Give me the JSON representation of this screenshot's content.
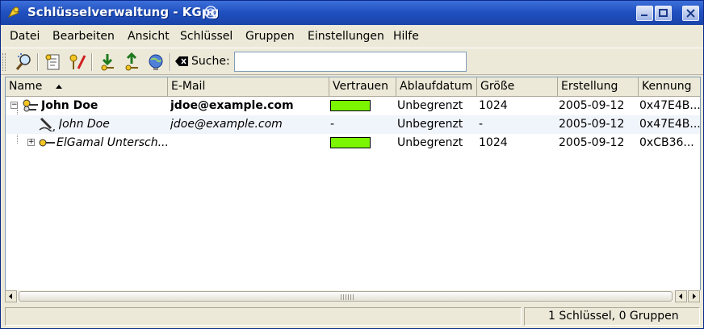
{
  "window": {
    "title": "Schlüsselverwaltung - KGpg",
    "buttons": [
      "minimize",
      "maximize",
      "close"
    ]
  },
  "menubar": [
    {
      "label": "Datei"
    },
    {
      "label": "Bearbeiten"
    },
    {
      "label": "Ansicht"
    },
    {
      "label": "Schlüssel"
    },
    {
      "label": "Gruppen"
    },
    {
      "label": "Einstellungen"
    },
    {
      "label": "Hilfe"
    }
  ],
  "toolbar": {
    "icons": [
      "find-key-icon",
      "key-properties-icon",
      "key-sign-edit-icon",
      "import-key-icon",
      "export-key-icon",
      "keyserver-globe-icon"
    ],
    "search_label": "Suche:",
    "search_value": "",
    "search_placeholder": ""
  },
  "columns": [
    "Name",
    "E-Mail",
    "Vertrauen",
    "Ablaufdatum",
    "Größe",
    "Erstellung",
    "Kennung"
  ],
  "rows": [
    {
      "name": "John Doe",
      "email": "jdoe@example.com",
      "trust": "bar",
      "expiry": "Unbegrenzt",
      "size": "1024",
      "created": "2005-09-12",
      "id": "0x47E4B...",
      "style": "bold",
      "expander": "−",
      "icon": "keypair-icon"
    },
    {
      "name": "John Doe",
      "email": "jdoe@example.com",
      "trust": "-",
      "expiry": "Unbegrenzt",
      "size": "-",
      "created": "2005-09-12",
      "id": "0x47E4B...",
      "style": "italic",
      "expander": "",
      "icon": "signature-pen-icon"
    },
    {
      "name": "ElGamal Untersch...",
      "email": "",
      "trust": "bar",
      "expiry": "Unbegrenzt",
      "size": "1024",
      "created": "2005-09-12",
      "id": "0xCB36...",
      "style": "italic",
      "expander": "+",
      "icon": "subkey-icon"
    }
  ],
  "trust_color": "#7cf500",
  "status": {
    "left": "",
    "right": "1 Schlüssel, 0 Gruppen"
  }
}
